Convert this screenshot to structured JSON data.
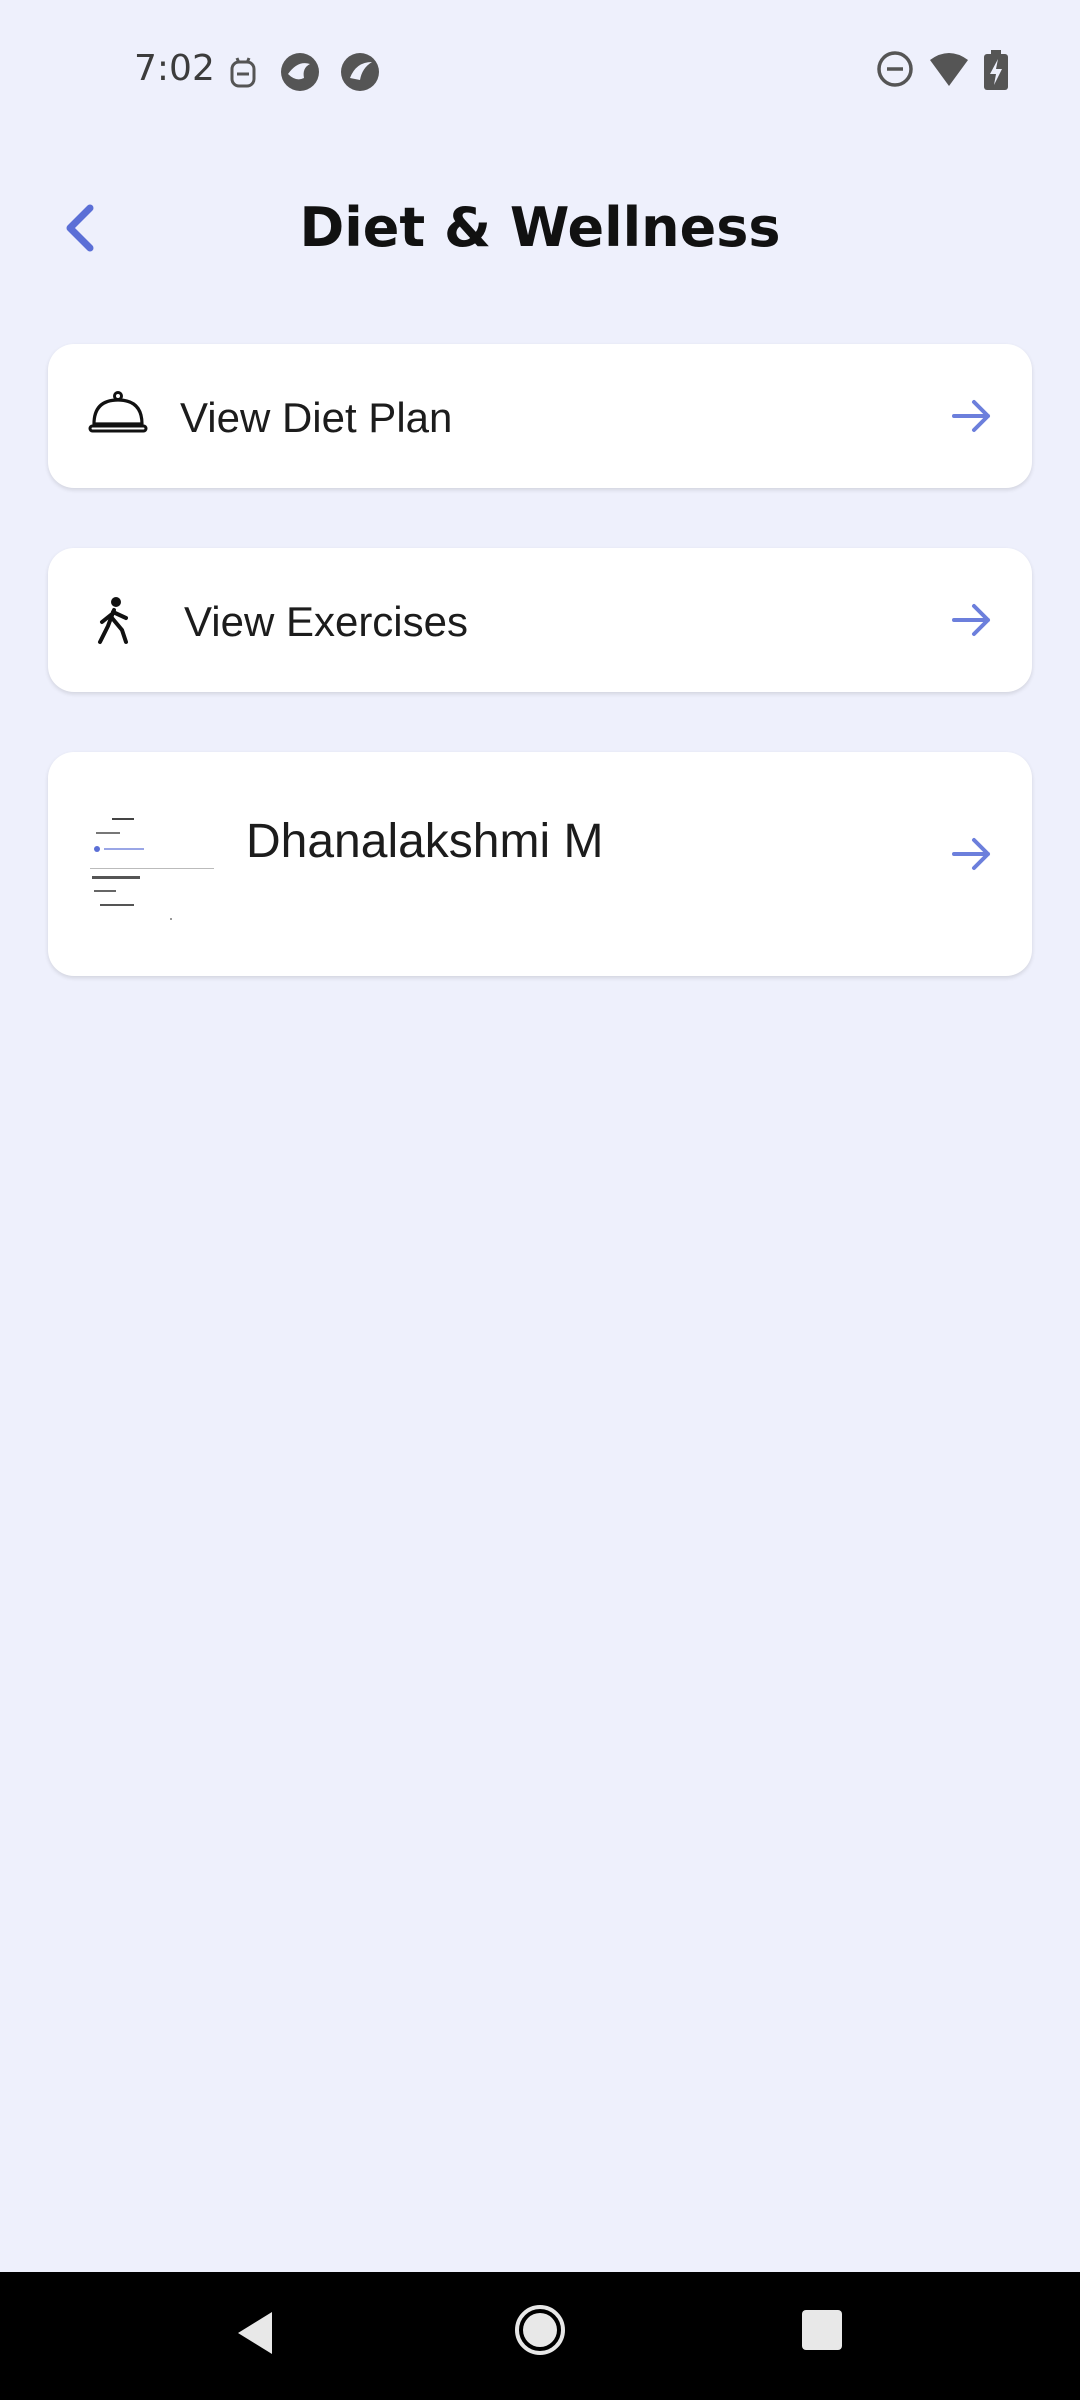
{
  "status_bar": {
    "time": "7:02",
    "left_icons": [
      "robot-icon",
      "app-icon-1",
      "app-icon-2"
    ],
    "right_icons": [
      "dnd-icon",
      "wifi-icon",
      "battery-charging-icon"
    ]
  },
  "header": {
    "title": "Diet & Wellness",
    "back_icon": "chevron-left-icon"
  },
  "menu": {
    "items": [
      {
        "label": "View Diet Plan",
        "icon": "cloche-icon",
        "action_icon": "arrow-right-icon"
      },
      {
        "label": "View Exercises",
        "icon": "walking-icon",
        "action_icon": "arrow-right-icon"
      },
      {
        "label": "Dhanalakshmi M",
        "icon": "profile-thumbnail",
        "action_icon": "arrow-right-icon"
      }
    ]
  },
  "nav_bar": {
    "buttons": [
      "back-triangle-icon",
      "home-circle-icon",
      "recents-square-icon"
    ]
  },
  "colors": {
    "background": "#eef0fc",
    "accent": "#5b6fd6",
    "card": "#ffffff"
  }
}
